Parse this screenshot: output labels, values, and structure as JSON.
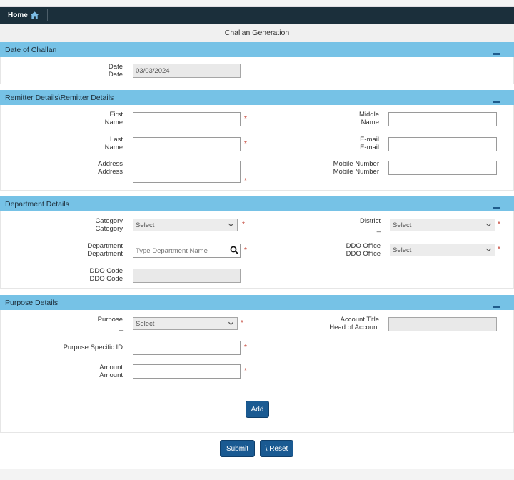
{
  "nav": {
    "home_label": "Home"
  },
  "page": {
    "title": "Challan Generation"
  },
  "date_section": {
    "title": "Date of Challan",
    "date_label_1": "Date",
    "date_label_2": "Date",
    "date_value": "03/03/2024"
  },
  "remitter_section": {
    "title": "Remitter Details\\Remitter Details",
    "first_label_1": "First",
    "first_label_2": "Name",
    "middle_label_1": "Middle",
    "middle_label_2": "Name",
    "last_label_1": "Last",
    "last_label_2": "Name",
    "email_label_1": "E-mail",
    "email_label_2": "E-mail",
    "address_label_1": "Address",
    "address_label_2": "Address",
    "mobile_label_1": "Mobile Number",
    "mobile_label_2": "Mobile Number",
    "required_mark": "*"
  },
  "department_section": {
    "title": "Department Details",
    "category_label_1": "Category",
    "category_label_2": "Category",
    "category_value": "Select",
    "district_label_1": "District",
    "district_label_2": "_",
    "district_value": "Select",
    "department_label_1": "Department",
    "department_label_2": "Department",
    "department_placeholder": "Type Department Name",
    "ddo_office_label_1": "DDO Office",
    "ddo_office_label_2": "DDO Office",
    "ddo_office_value": "Select",
    "ddo_code_label_1": "DDO Code",
    "ddo_code_label_2": "DDO Code"
  },
  "purpose_section": {
    "title": "Purpose Details",
    "purpose_label_1": "Purpose",
    "purpose_label_2": "_",
    "purpose_value": "Select",
    "account_title_label_1": "Account Title",
    "account_title_label_2": "Head of Account",
    "purpose_id_label": "Purpose Specific ID",
    "amount_label_1": "Amount",
    "amount_label_2": "Amount",
    "add_label": "Add"
  },
  "actions": {
    "submit_label": "Submit",
    "reset_label": "\\ Reset"
  },
  "colors": {
    "navbar": "#1b2f3b",
    "panel_header": "#76c2e6",
    "button": "#1a5a92",
    "required": "#c0392b"
  }
}
